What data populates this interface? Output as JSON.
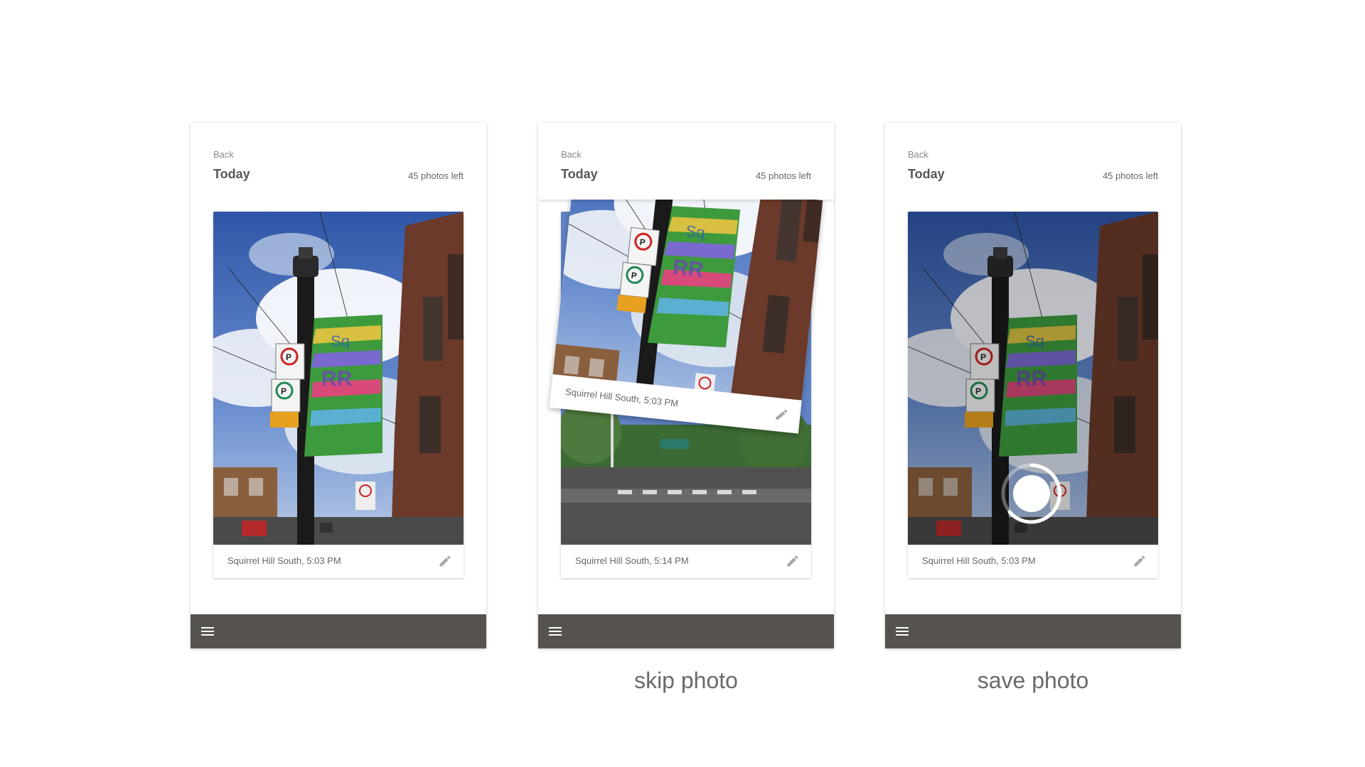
{
  "screens": [
    {
      "back_label": "Back",
      "title": "Today",
      "photos_left": "45 photos left",
      "caption": "Squirrel Hill South, 5:03 PM",
      "caption_label": ""
    },
    {
      "back_label": "Back",
      "title": "Today",
      "photos_left": "45 photos left",
      "caption": "Squirrel Hill South, 5:14 PM",
      "flying_caption": "Squirrel Hill South, 5:03 PM",
      "caption_label": "skip photo"
    },
    {
      "back_label": "Back",
      "title": "Today",
      "photos_left": "45 photos left",
      "caption": "Squirrel Hill South, 5:03 PM",
      "caption_label": "save photo"
    }
  ],
  "icons": {
    "menu": "hamburger-menu-icon",
    "edit": "pencil-icon",
    "spinner": "progress-spinner"
  },
  "colors": {
    "bottom_bar": "#56534f",
    "title": "#5a5652",
    "muted_text": "#888888"
  }
}
